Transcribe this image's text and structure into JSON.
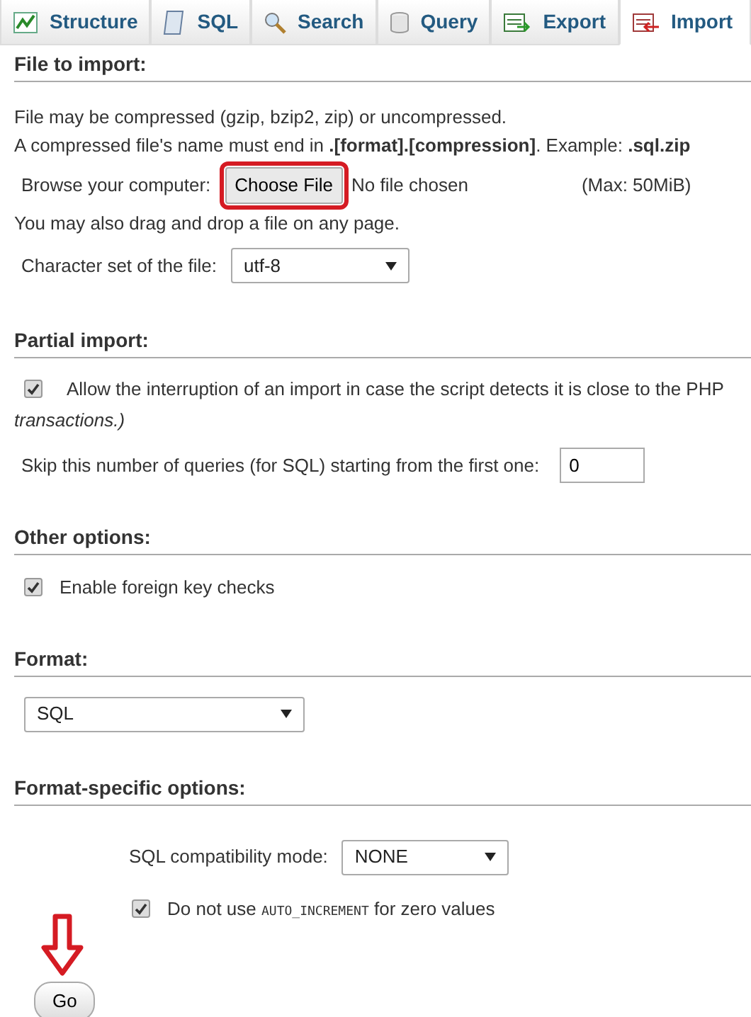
{
  "tabs": [
    {
      "label": "Structure",
      "selected": false
    },
    {
      "label": "SQL",
      "selected": false
    },
    {
      "label": "Search",
      "selected": false
    },
    {
      "label": "Query",
      "selected": false
    },
    {
      "label": "Export",
      "selected": false
    },
    {
      "label": "Import",
      "selected": true
    }
  ],
  "file_to_import": {
    "heading": "File to import:",
    "note_1": "File may be compressed (gzip, bzip2, zip) or uncompressed.",
    "note_2": "A compressed file's name must end in **.[format].[compression]**. Example: **.sql.zip**",
    "browse_label": "Browse your computer:",
    "choose_button": "Choose File",
    "choose_highlighted": true,
    "file_status": "No file chosen",
    "max_size": "(Max: 50MiB)",
    "drag_note": "You may also drag and drop a file on any page.",
    "charset_label": "Character set of the file:",
    "charset_value": "utf-8"
  },
  "partial_import": {
    "heading": "Partial import:",
    "allow_interrupt": {
      "checked": true,
      "label": "Allow the interruption of an import in case the script detects it is close to the PHP",
      "continuation": "transactions.)"
    },
    "skip_label": "Skip this number of queries (for SQL) starting from the first one:",
    "skip_value": "0"
  },
  "other_options": {
    "heading": "Other options:",
    "foreign_key_checks": {
      "checked": true,
      "label": "Enable foreign key checks"
    }
  },
  "format": {
    "heading": "Format:",
    "value": "SQL"
  },
  "format_specific": {
    "heading": "Format-specific options:",
    "compat_label": "SQL compatibility mode:",
    "compat_value": "NONE",
    "auto_increment": {
      "checked": true,
      "label_before": "Do not use",
      "label_code": "AUTO_INCREMENT",
      "label_after": "for zero values"
    }
  },
  "go": {
    "label": "Go",
    "arrow": true
  }
}
